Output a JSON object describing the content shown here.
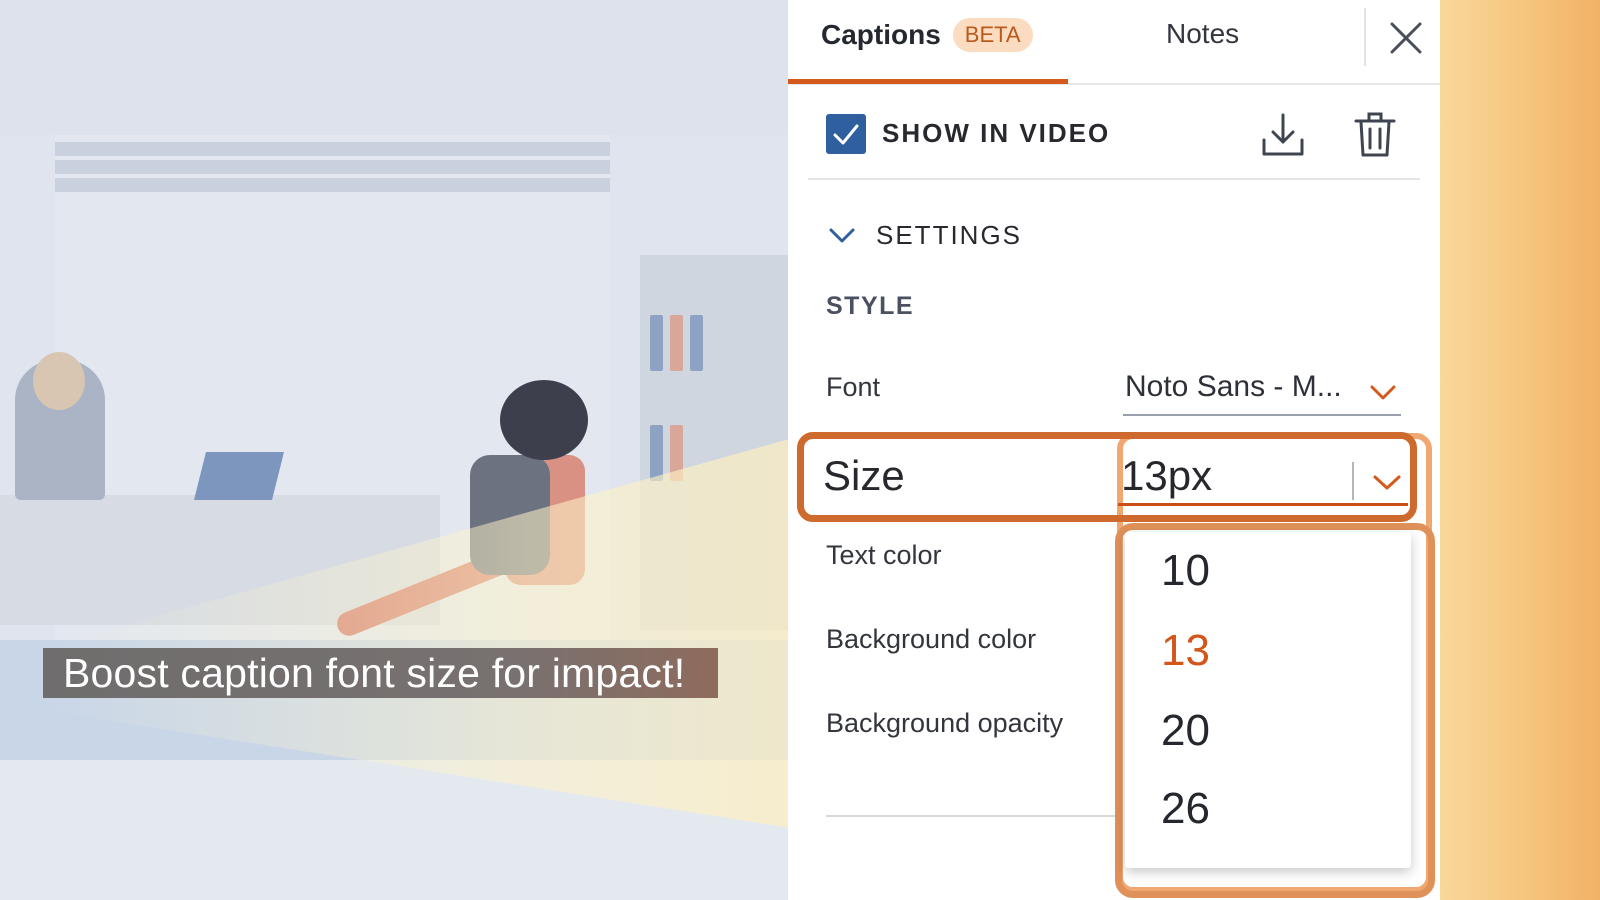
{
  "scene": {
    "caption_text": "Boost caption font size for impact!"
  },
  "panel": {
    "tabs": [
      {
        "label": "Captions",
        "badge": "BETA",
        "active": true
      },
      {
        "label": "Notes",
        "active": false
      }
    ],
    "close_icon": "close-icon",
    "show_in_video": {
      "label": "SHOW IN VIDEO",
      "checked": true
    },
    "download_icon": "download-icon",
    "trash_icon": "trash-icon",
    "settings": {
      "label": "SETTINGS",
      "expanded": true
    },
    "style_heading": "STYLE",
    "font": {
      "label": "Font",
      "value": "Noto Sans - M..."
    },
    "size": {
      "label": "Size",
      "value": "13px"
    },
    "text_color": {
      "label": "Text color"
    },
    "background_color": {
      "label": "Background color"
    },
    "background_opacity": {
      "label": "Background opacity"
    },
    "size_options": [
      "10",
      "13",
      "20",
      "26"
    ],
    "size_selected": "13"
  },
  "colors": {
    "accent": "#d35a1c",
    "checkbox": "#2f5f9e",
    "highlight_frame": "#cf6a2e",
    "beta_bg": "#fcdcc0"
  }
}
